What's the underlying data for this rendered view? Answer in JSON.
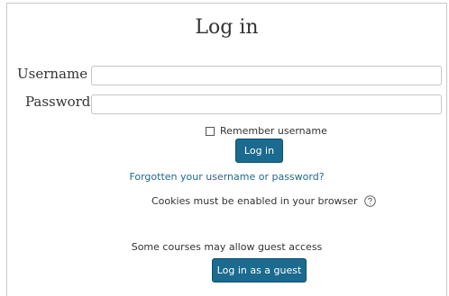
{
  "page": {
    "title": "Log in"
  },
  "form": {
    "username_label": "Username",
    "password_label": "Password",
    "username_value": "",
    "password_value": "",
    "remember_label": "Remember username",
    "remember_checked": false,
    "login_button": "Log in"
  },
  "links": {
    "forgot": "Forgotten your username or password?"
  },
  "cookies": {
    "text": "Cookies must be enabled in your browser",
    "icon": "question-circle-icon"
  },
  "guest": {
    "text": "Some courses may allow guest access",
    "button": "Log in as a guest"
  },
  "colors": {
    "primary": "#1b6a8f",
    "link": "#1b6a8f"
  }
}
